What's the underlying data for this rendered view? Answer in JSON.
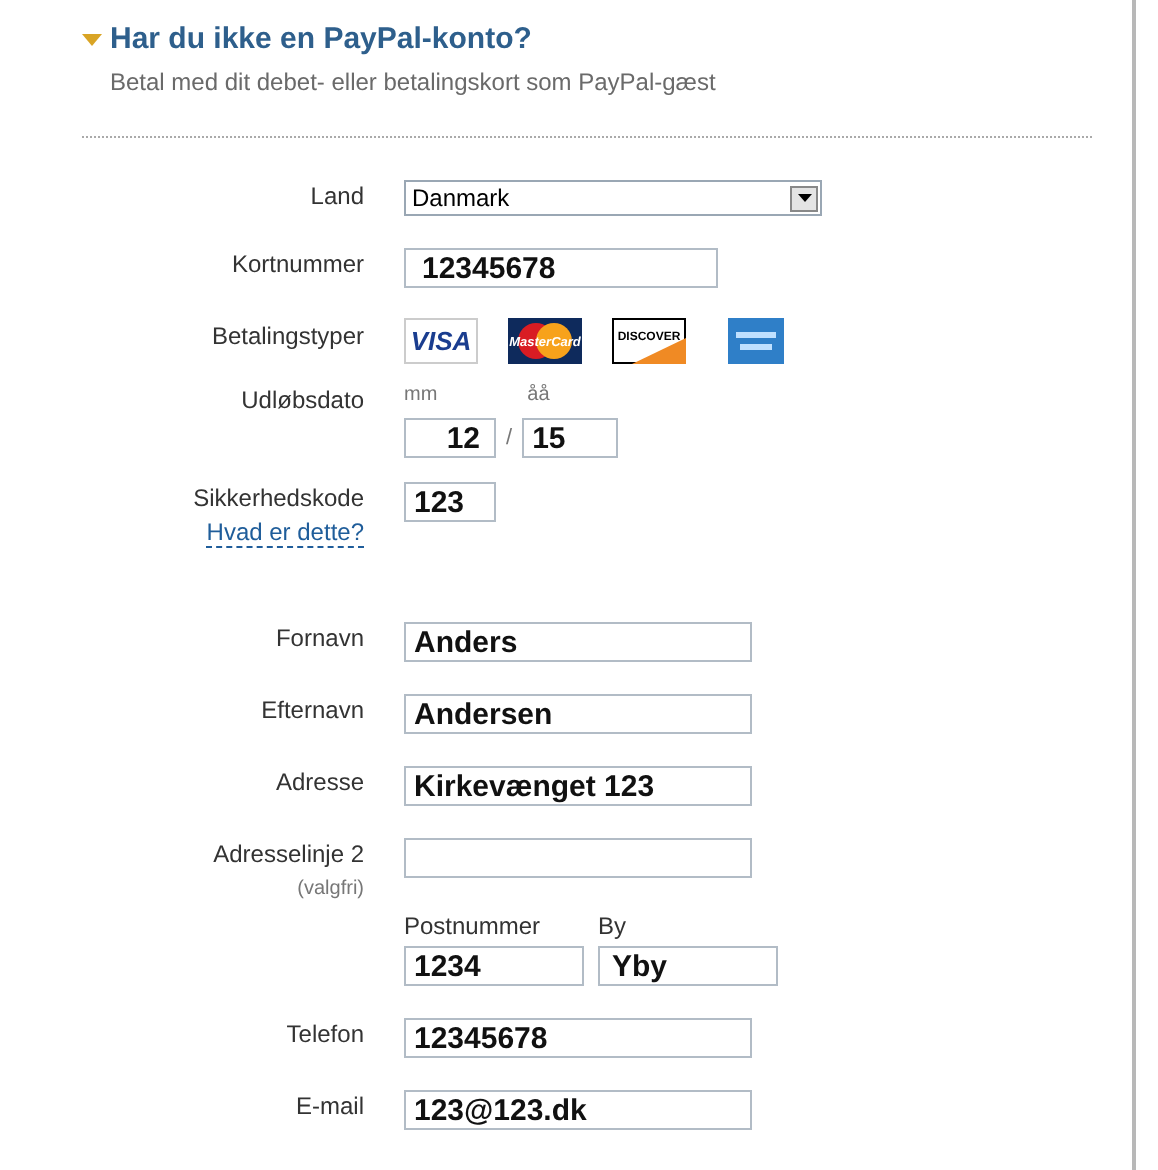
{
  "section": {
    "expanded": true,
    "title": "Har du ikke en PayPal-konto?",
    "subtitle": "Betal med dit debet- eller betalingskort som PayPal-gæst"
  },
  "card_fields": [
    {
      "kind": "select",
      "label": "Land",
      "value": "Danmark"
    },
    {
      "kind": "card-number",
      "label": "Kortnummer",
      "value": "12345678"
    },
    {
      "kind": "cards",
      "label": "Betalingstyper",
      "cards": [
        {
          "kind": "visa",
          "text": "VISA"
        },
        {
          "kind": "mastercard",
          "text": "MasterCard"
        },
        {
          "kind": "discover",
          "text": "DISCOVER"
        },
        {
          "kind": "amex"
        }
      ]
    },
    {
      "kind": "date",
      "label": "Udløbsdato",
      "month_label": "mm",
      "month": "12",
      "separator": "/",
      "year_label": "åå",
      "year": "15"
    },
    {
      "kind": "code",
      "label": "Sikkerhedskode",
      "link": "Hvad er dette?",
      "value": "123"
    }
  ],
  "address_fields": [
    {
      "kind": "text",
      "label": "Fornavn",
      "value": "Anders"
    },
    {
      "kind": "text",
      "label": "Efternavn",
      "value": "Andersen"
    },
    {
      "kind": "text",
      "label": "Adresse",
      "value": "Kirkevænget 123"
    },
    {
      "kind": "text",
      "label": "Adresselinje 2",
      "note": "(valgfri)"
    },
    {
      "kind": "postcity",
      "postal_label": "Postnummer",
      "postal": "1234",
      "city_label": "By",
      "city": "Yby"
    },
    {
      "kind": "text",
      "label": "Telefon",
      "value": "12345678"
    },
    {
      "kind": "text",
      "label": "E-mail",
      "value": "123@123.dk"
    }
  ]
}
